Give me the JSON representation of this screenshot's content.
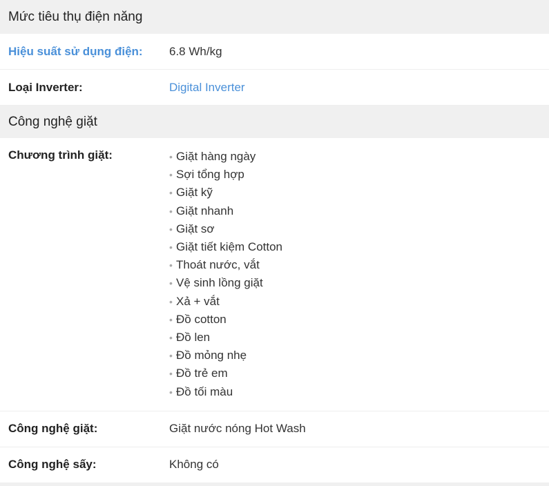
{
  "sections": {
    "power": {
      "title": "Mức tiêu thụ điện năng",
      "efficiency_label": "Hiệu suất sử dụng điện:",
      "efficiency_value": "6.8 Wh/kg",
      "inverter_label": "Loại Inverter:",
      "inverter_value": "Digital Inverter"
    },
    "washing": {
      "title": "Công nghệ giặt",
      "programs_label": "Chương trình giặt:",
      "programs": [
        "Giặt hàng ngày",
        "Sợi tổng hợp",
        "Giặt kỹ",
        "Giặt nhanh",
        "Giặt sơ",
        "Giặt tiết kiệm Cotton",
        "Thoát nước, vắt",
        "Vệ sinh lồng giặt",
        "Xả + vắt",
        "Đồ cotton",
        "Đồ len",
        "Đồ mỏng nhẹ",
        "Đồ trẻ em",
        "Đồ tối màu"
      ],
      "wash_tech_label": "Công nghệ giặt:",
      "wash_tech_value": "Giặt nước nóng Hot Wash",
      "dry_tech_label": "Công nghệ sấy:",
      "dry_tech_value": "Không có"
    }
  },
  "icons": {
    "bullet": "•"
  },
  "colors": {
    "link": "#4a90d9",
    "header_bg": "#f0f0f0"
  }
}
